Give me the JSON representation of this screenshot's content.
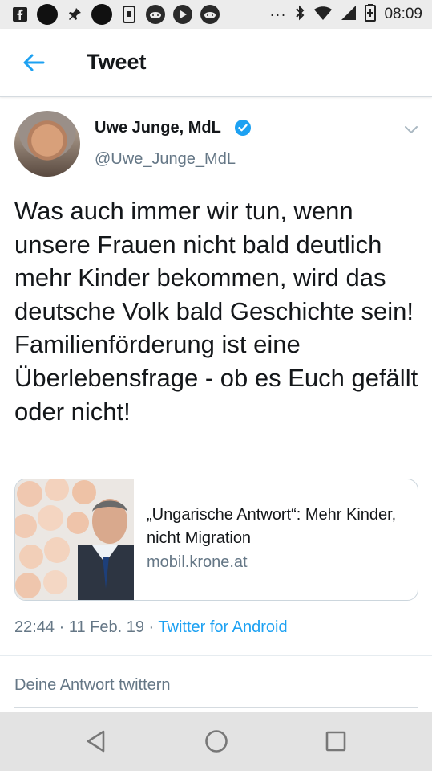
{
  "status_bar": {
    "time": "08:09",
    "more_glyph": "···",
    "icons": [
      "facebook-icon",
      "dot-icon",
      "pin-icon",
      "dot-icon",
      "screenshot-icon",
      "alien-app-icon",
      "play-icon",
      "alien-app-icon",
      "bluetooth-icon",
      "wifi-icon",
      "signal-icon",
      "battery-charging-icon"
    ]
  },
  "app_bar": {
    "title": "Tweet",
    "back_icon": "arrow-left-icon"
  },
  "tweet": {
    "author_name": "Uwe Junge, MdL",
    "handle": "@Uwe_Junge_MdL",
    "text": "Was auch immer wir tun, wenn unsere Frauen nicht bald deutlich mehr Kinder bekommen, wird das deutsche Volk bald Geschichte sein! Familienförderung ist eine Überlebensfrage - ob es Euch gefällt oder nicht!",
    "card": {
      "title": "„Ungarische Antwort“: Mehr Kinder, nicht Migration",
      "domain": "mobil.krone.at"
    },
    "meta": {
      "time": "22:44",
      "sep1": " · ",
      "date": "11 Feb. 19",
      "sep2": " · ",
      "source": "Twitter for Android"
    }
  },
  "reply_placeholder": "Deine Antwort twittern",
  "colors": {
    "accent": "#1da1f2",
    "text": "#14171a",
    "secondary": "#657786",
    "status_bar_bg": "#ececec",
    "nav_bar_bg": "#e3e3e3"
  }
}
